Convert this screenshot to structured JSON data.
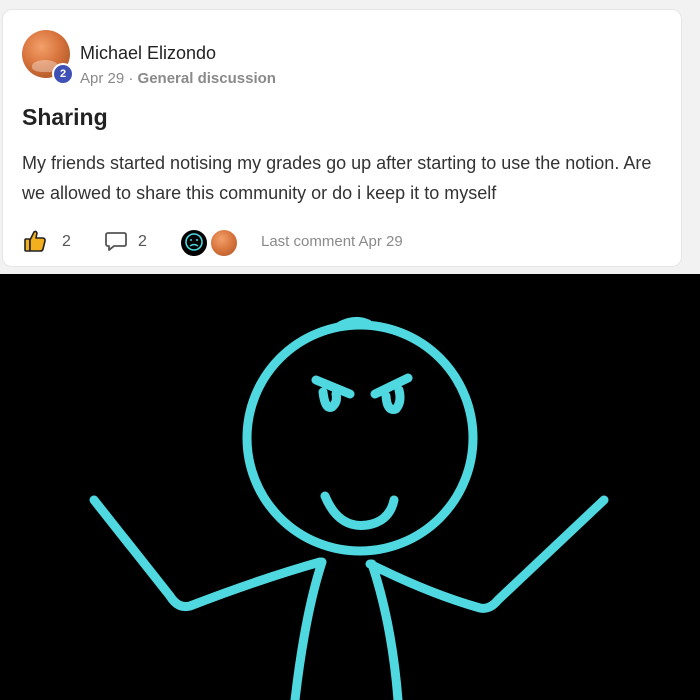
{
  "post": {
    "author": "Michael Elizondo",
    "level": "2",
    "date": "Apr 29",
    "separator": "·",
    "category": "General discussion",
    "title": "Sharing",
    "body": "My friends started notising my grades go up after starting to use the notion. Are we allowed to share this community or do i keep it to myself",
    "likes": "2",
    "comments": "2",
    "last_comment": "Last comment Apr 29"
  },
  "icons": {
    "like": "thumbs-up-icon",
    "comment": "speech-bubble-icon"
  },
  "colors": {
    "level_badge": "#3f51b5",
    "like_icon": "#f2b01e",
    "drawing_background": "#000000",
    "stick_figure": "#4fd8e0"
  }
}
